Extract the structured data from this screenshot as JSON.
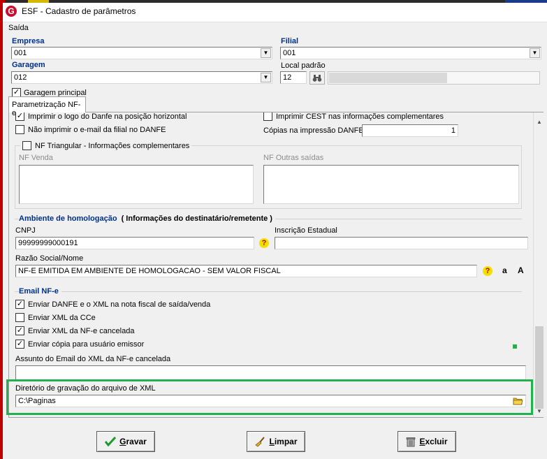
{
  "window": {
    "title": "ESF - Cadastro de parâmetros",
    "logo": "G"
  },
  "menu": {
    "items": [
      "Saída"
    ]
  },
  "header": {
    "empresa_label": "Empresa",
    "empresa_value": "001",
    "filial_label": "Filial",
    "filial_value": "001",
    "garagem_label": "Garagem",
    "garagem_value": "012",
    "local_padrao_label": "Local padrão",
    "local_padrao_value": "12",
    "garagem_principal_label": "Garagem principal"
  },
  "tabs": [
    {
      "label": "Parametrização NF-e",
      "active": true
    }
  ],
  "nfe": {
    "imprimir_logo_label": "Imprimir o logo do Danfe na posição horizontal",
    "nao_imprimir_email_label": "Não imprimir o e-mail da filial no DANFE",
    "imprimir_cest_label": "Imprimir CEST nas informações complementares",
    "copias_label": "Cópias na impressão DANFE",
    "copias_value": "1",
    "nf_triangular_label": "NF Triangular - Informações complementares",
    "nf_venda_label": "NF Venda",
    "nf_outras_label": "NF Outras saídas"
  },
  "homologacao": {
    "title": "Ambiente de homologação",
    "subtitle": "( Informações do destinatário/remetente )",
    "cnpj_label": "CNPJ",
    "cnpj_value": "99999999000191",
    "ie_label": "Inscrição Estadual",
    "ie_value": "",
    "razao_label": "Razão Social/Nome",
    "razao_value": "NF-E EMITIDA EM AMBIENTE DE HOMOLOGACAO - SEM VALOR FISCAL",
    "lower_btn": "a",
    "upper_btn": "A",
    "help": "?"
  },
  "email": {
    "title": "Email NF-e",
    "enviar_danfe_label": "Enviar DANFE e o XML na nota fiscal de saída/venda",
    "enviar_cce_label": "Enviar XML da CCe",
    "enviar_cancelada_label": "Enviar XML da NF-e cancelada",
    "enviar_copia_label": "Enviar cópia para usuário emissor",
    "assunto_label": "Assunto do Email do XML da NF-e cancelada",
    "assunto_value": ""
  },
  "xml": {
    "dir_label": "Diretório de gravação do arquivo de XML",
    "dir_value": "C:\\Paginas"
  },
  "buttons": {
    "gravar_first": "G",
    "gravar_rest": "ravar",
    "limpar_first": "L",
    "limpar_rest": "impar",
    "excluir_first": "E",
    "excluir_rest": "xcluir"
  },
  "colors": {
    "accent": "#003087",
    "highlight": "#22b14c",
    "brand": "#c8102e"
  }
}
